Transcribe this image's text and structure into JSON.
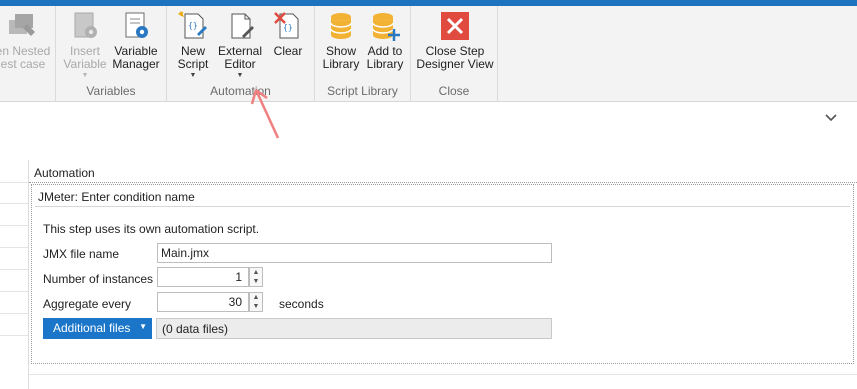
{
  "ribbon": {
    "buttons": {
      "nested_line1": "en Nested",
      "nested_line2": "est case",
      "insert_line1": "Insert",
      "insert_line2": "Variable",
      "varmgr_line1": "Variable",
      "varmgr_line2": "Manager",
      "newscript_line1": "New",
      "newscript_line2": "Script",
      "exteditor_line1": "External",
      "exteditor_line2": "Editor",
      "clear": "Clear",
      "showlib_line1": "Show",
      "showlib_line2": "Library",
      "addlib_line1": "Add to",
      "addlib_line2": "Library",
      "closestep_line1": "Close Step",
      "closestep_line2": "Designer View"
    },
    "groups": {
      "variables": "Variables",
      "automation": "Automation",
      "script_library": "Script Library",
      "close": "Close"
    }
  },
  "automation_header": "Automation",
  "panel": {
    "title": "JMeter: Enter condition name",
    "description": "This step uses its own automation script.",
    "jmx_label": "JMX file name",
    "jmx_value": "Main.jmx",
    "instances_label": "Number of instances",
    "instances_value": "1",
    "aggregate_label": "Aggregate every",
    "aggregate_value": "30",
    "aggregate_unit": "seconds",
    "additional_files_label": "Additional files",
    "data_files_text": "(0 data files)"
  },
  "colors": {
    "accent": "#1e73be",
    "button_blue": "#1b76c9",
    "close_red": "#e04a3f",
    "db_yellow": "#f2b233",
    "annotation_arrow": "#f08080"
  }
}
